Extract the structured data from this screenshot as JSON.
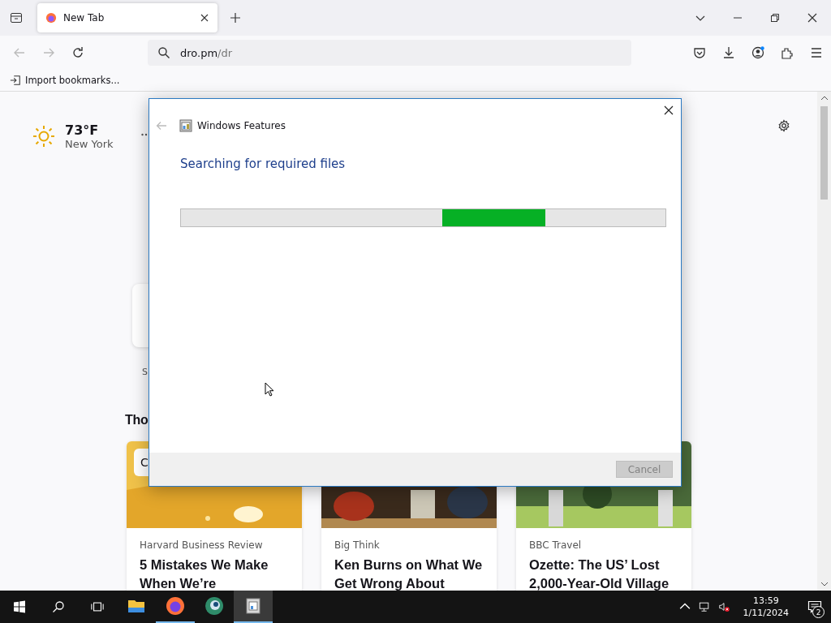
{
  "browser": {
    "tabs": [
      {
        "label": "New Tab",
        "selected": true
      }
    ],
    "address": {
      "host": "dro.pm",
      "path": "/dr"
    },
    "bookmarks": [
      {
        "label": "Import bookmarks..."
      }
    ]
  },
  "newtab": {
    "weather": {
      "temperature": "73°F",
      "location": "New York"
    },
    "fragments": {
      "shortcut_label": "S",
      "section_heading": "Tho",
      "card_badge": "C"
    },
    "stories": [
      {
        "source": "Harvard Business Review",
        "title": "5 Mistakes We Make When We’re"
      },
      {
        "source": "Big Think",
        "title": "Ken Burns on What We Get Wrong About"
      },
      {
        "source": "BBC Travel",
        "title": "Ozette: The US’ Lost 2,000-Year-Old Village"
      }
    ]
  },
  "dialog": {
    "title": "Windows Features",
    "heading": "Searching for required files",
    "progress": {
      "kind": "marquee"
    },
    "buttons": [
      {
        "label": "Cancel",
        "disabled": true
      }
    ]
  },
  "taskbar": {
    "apps": [
      {
        "kind": "explorer",
        "running": false,
        "active": false
      },
      {
        "kind": "firefox",
        "running": true,
        "active": false
      },
      {
        "kind": "globe",
        "running": false,
        "active": false
      },
      {
        "kind": "features",
        "running": true,
        "active": true
      }
    ],
    "volume_muted": true,
    "clock": {
      "time": "13:59",
      "date": "1/11/2024"
    },
    "notifications": "2"
  }
}
